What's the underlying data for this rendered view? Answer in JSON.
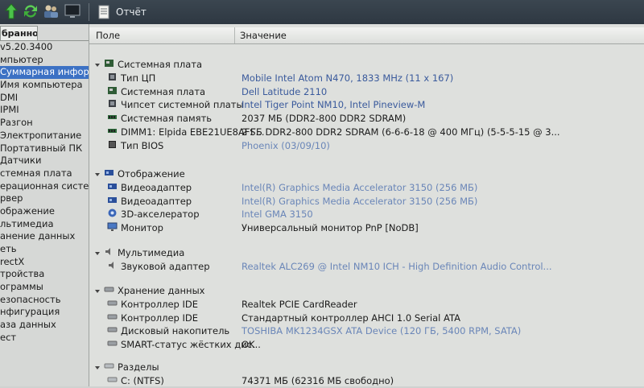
{
  "toolbar": {
    "report_label": "Отчёт",
    "icons": [
      "refresh-up-icon",
      "refresh-icon",
      "users-icon",
      "monitor-icon",
      "report-icon"
    ]
  },
  "left_panel": {
    "tab_label": "бранное",
    "items": [
      {
        "label": "v5.20.3400",
        "selected": false
      },
      {
        "label": "мпьютер",
        "selected": false
      },
      {
        "label": "Суммарная информа",
        "selected": true
      },
      {
        "label": "Имя компьютера",
        "selected": false
      },
      {
        "label": "DMI",
        "selected": false
      },
      {
        "label": "IPMI",
        "selected": false
      },
      {
        "label": "Разгон",
        "selected": false
      },
      {
        "label": "Электропитание",
        "selected": false
      },
      {
        "label": "Портативный ПК",
        "selected": false
      },
      {
        "label": "Датчики",
        "selected": false
      },
      {
        "label": "стемная плата",
        "selected": false
      },
      {
        "label": "ерационная система",
        "selected": false
      },
      {
        "label": "рвер",
        "selected": false
      },
      {
        "label": "ображение",
        "selected": false
      },
      {
        "label": "льтимедиа",
        "selected": false
      },
      {
        "label": "анение данных",
        "selected": false
      },
      {
        "label": "еть",
        "selected": false
      },
      {
        "label": "rectX",
        "selected": false
      },
      {
        "label": "тройства",
        "selected": false
      },
      {
        "label": "ограммы",
        "selected": false
      },
      {
        "label": "езопасность",
        "selected": false
      },
      {
        "label": "нфигурация",
        "selected": false
      },
      {
        "label": "аза данных",
        "selected": false
      },
      {
        "label": "ест",
        "selected": false
      }
    ]
  },
  "columns": {
    "field": "Поле",
    "value": "Значение"
  },
  "groups": [
    {
      "title": "Системная плата",
      "rows": [
        {
          "field": "Тип ЦП",
          "value": "Mobile Intel Atom N470, 1833 MHz (11 x 167)"
        },
        {
          "field": "Системная плата",
          "value": "Dell Latitude 2110"
        },
        {
          "field": "Чипсет системной платы",
          "value": "Intel Tiger Point NM10, Intel Pineview-M"
        },
        {
          "field": "Системная память",
          "value": "2037 МБ  (DDR2-800 DDR2 SDRAM)"
        },
        {
          "field": "DIMM1: Elpida EBE21UE8AFS...",
          "value": "2 ГБ DDR2-800 DDR2 SDRAM  (6-6-6-18 @ 400 МГц)  (5-5-5-15 @ 3..."
        },
        {
          "field": "Тип BIOS",
          "value": "Phoenix (03/09/10)"
        }
      ]
    },
    {
      "title": "Отображение",
      "rows": [
        {
          "field": "Видеоадаптер",
          "value": "Intel(R) Graphics Media Accelerator 3150  (256 МБ)"
        },
        {
          "field": "Видеоадаптер",
          "value": "Intel(R) Graphics Media Accelerator 3150  (256 МБ)"
        },
        {
          "field": "3D-акселератор",
          "value": "Intel GMA 3150"
        },
        {
          "field": "Монитор",
          "value": "Универсальный монитор PnP [NoDB]"
        }
      ]
    },
    {
      "title": "Мультимедиа",
      "rows": [
        {
          "field": "Звуковой адаптер",
          "value": "Realtek ALC269 @ Intel NM10 ICH - High Definition Audio Control..."
        }
      ]
    },
    {
      "title": "Хранение данных",
      "rows": [
        {
          "field": "Контроллер IDE",
          "value": "Realtek PCIE CardReader"
        },
        {
          "field": "Контроллер IDE",
          "value": "Стандартный контроллер AHCI 1.0 Serial ATA"
        },
        {
          "field": "Дисковый накопитель",
          "value": "TOSHIBA MK1234GSX ATA Device  (120 ГБ, 5400 RPM, SATA)"
        },
        {
          "field": "SMART-статус жёстких дис...",
          "value": "OK"
        }
      ]
    },
    {
      "title": "Разделы",
      "rows": [
        {
          "field": "C: (NTFS)",
          "value": "74371 МБ (62316 МБ свободно)"
        }
      ]
    }
  ]
}
